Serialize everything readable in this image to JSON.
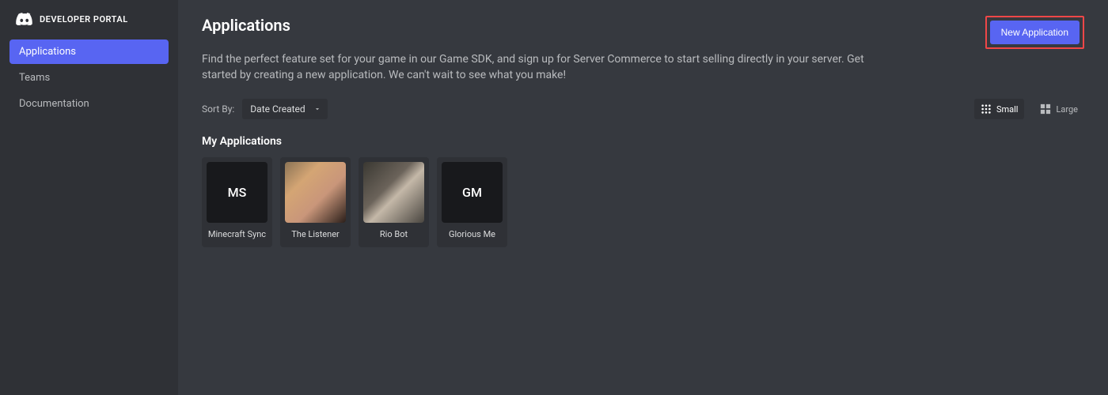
{
  "sidebar": {
    "title": "DEVELOPER PORTAL",
    "items": [
      {
        "label": "Applications",
        "active": true
      },
      {
        "label": "Teams",
        "active": false
      },
      {
        "label": "Documentation",
        "active": false
      }
    ]
  },
  "header": {
    "title": "Applications",
    "new_button": "New Application",
    "description": "Find the perfect feature set for your game in our Game SDK, and sign up for Server Commerce to start selling directly in your server. Get started by creating a new application. We can't wait to see what you make!"
  },
  "sort": {
    "label": "Sort By:",
    "value": "Date Created"
  },
  "view": {
    "small": "Small",
    "large": "Large"
  },
  "section": {
    "title": "My Applications"
  },
  "apps": [
    {
      "name": "Minecraft Sync",
      "initials": "MS",
      "thumb_type": "initials"
    },
    {
      "name": "The Listener",
      "initials": "",
      "thumb_type": "img1"
    },
    {
      "name": "Rio Bot",
      "initials": "",
      "thumb_type": "img2"
    },
    {
      "name": "Glorious Me",
      "initials": "GM",
      "thumb_type": "initials"
    }
  ]
}
